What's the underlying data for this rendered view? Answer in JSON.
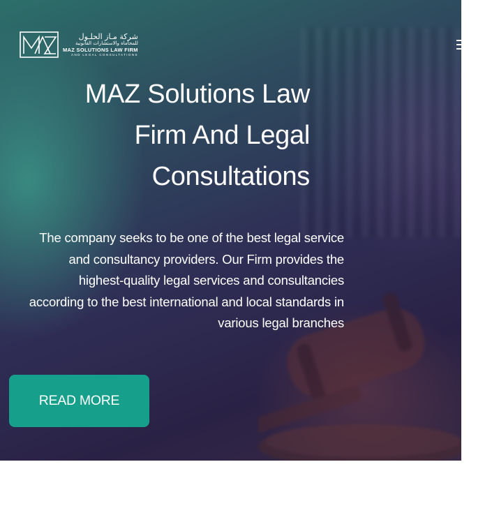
{
  "header": {
    "logo": {
      "monogram": "MAZ",
      "name_ar": "شركة مـاز الحلـول",
      "subtitle_ar": "للمحاماة والاستشارات القانونية",
      "name_en": "MAZ SOLUTIONS LAW FIRM",
      "subtitle_en": "AND LEGAL CONSULTATIONS"
    },
    "menu_icon": "hamburger-icon"
  },
  "hero": {
    "title_lines": [
      "MAZ Solutions Law",
      "Firm And Legal",
      "Consultations"
    ],
    "description_lines": [
      "The company seeks to be one of the best legal service",
      "and consultancy providers. Our Firm provides the",
      "highest-quality legal services and consultancies",
      "according to the best international and local standards in",
      "various legal branches"
    ],
    "cta_label": "READ MORE",
    "background_image": "courtroom-gavel-photo"
  },
  "colors": {
    "accent": "#16a08b",
    "text_on_hero": "#ffffff",
    "page_background": "#ffffff"
  }
}
